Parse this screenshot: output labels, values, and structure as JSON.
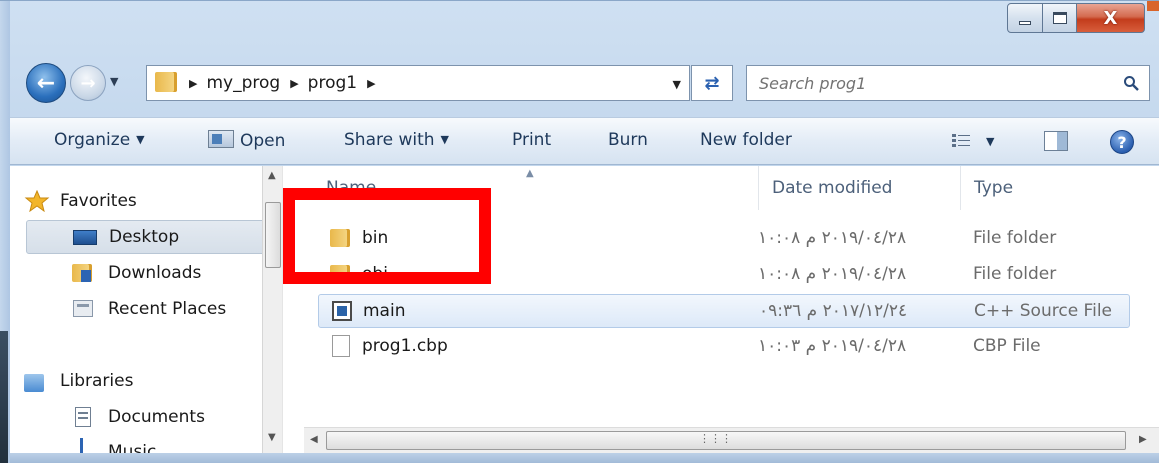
{
  "window": {
    "caption": {
      "close_glyph": "X"
    }
  },
  "address_bar": {
    "crumbs": [
      "my_prog",
      "prog1"
    ],
    "separator": "▶"
  },
  "search": {
    "placeholder": "Search prog1"
  },
  "toolbar": {
    "organize": "Organize",
    "open": "Open",
    "share_with": "Share with",
    "print": "Print",
    "burn": "Burn",
    "new_folder": "New folder"
  },
  "navigation": {
    "favorites": "Favorites",
    "desktop": "Desktop",
    "downloads": "Downloads",
    "recent_places": "Recent Places",
    "libraries": "Libraries",
    "documents": "Documents",
    "music": "Music"
  },
  "columns": {
    "name": "Name",
    "date_modified": "Date modified",
    "type": "Type"
  },
  "files": [
    {
      "name": "bin",
      "date": "٢٠١٩/٠٤/٢٨ م ١٠:٠٨",
      "type": "File folder"
    },
    {
      "name": "obj",
      "date": "٢٠١٩/٠٤/٢٨ م ١٠:٠٨",
      "type": "File folder"
    },
    {
      "name": "main",
      "date": "٢٠١٧/١٢/٢٤ م ٠٩:٣٦",
      "type": "C++ Source File"
    },
    {
      "name": "prog1.cbp",
      "date": "٢٠١٩/٠٤/٢٨ م ١٠:٠٣",
      "type": "CBP File"
    }
  ],
  "icons": {
    "back": "back-arrow-icon",
    "forward": "forward-arrow-icon",
    "refresh": "refresh-icon",
    "search": "magnifier-icon",
    "help": "help-icon"
  },
  "colors": {
    "annotation": "#ff0000",
    "selection": "#dde9f8"
  }
}
